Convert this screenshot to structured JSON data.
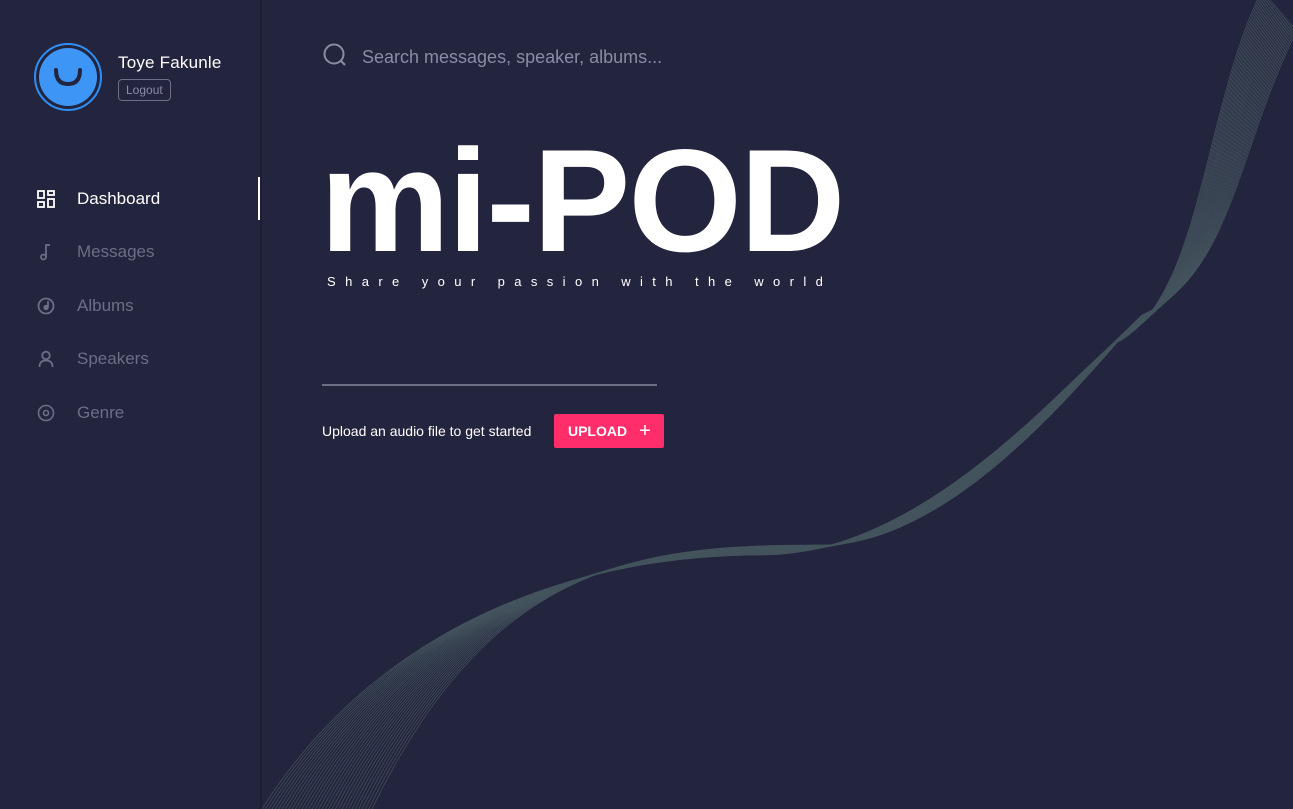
{
  "user": {
    "name": "Toye Fakunle",
    "logout_label": "Logout"
  },
  "sidebar": {
    "items": [
      {
        "label": "Dashboard",
        "icon": "dashboard-icon",
        "active": true
      },
      {
        "label": "Messages",
        "icon": "music-note-icon",
        "active": false
      },
      {
        "label": "Albums",
        "icon": "album-icon",
        "active": false
      },
      {
        "label": "Speakers",
        "icon": "person-icon",
        "active": false
      },
      {
        "label": "Genre",
        "icon": "disc-icon",
        "active": false
      }
    ]
  },
  "search": {
    "placeholder": "Search messages, speaker, albums...",
    "value": "",
    "icon": "search-icon"
  },
  "hero": {
    "title": "mi-POD",
    "tagline": "Share your passion with the world"
  },
  "upload": {
    "prompt": "Upload an audio file to get started",
    "button_label": "UPLOAD",
    "button_icon": "plus-icon"
  },
  "colors": {
    "background": "#23243d",
    "accent": "#ff2d6a",
    "avatar": "#3d95f5",
    "inactive_text": "#6c6e86",
    "wave": "#5f7b78"
  }
}
